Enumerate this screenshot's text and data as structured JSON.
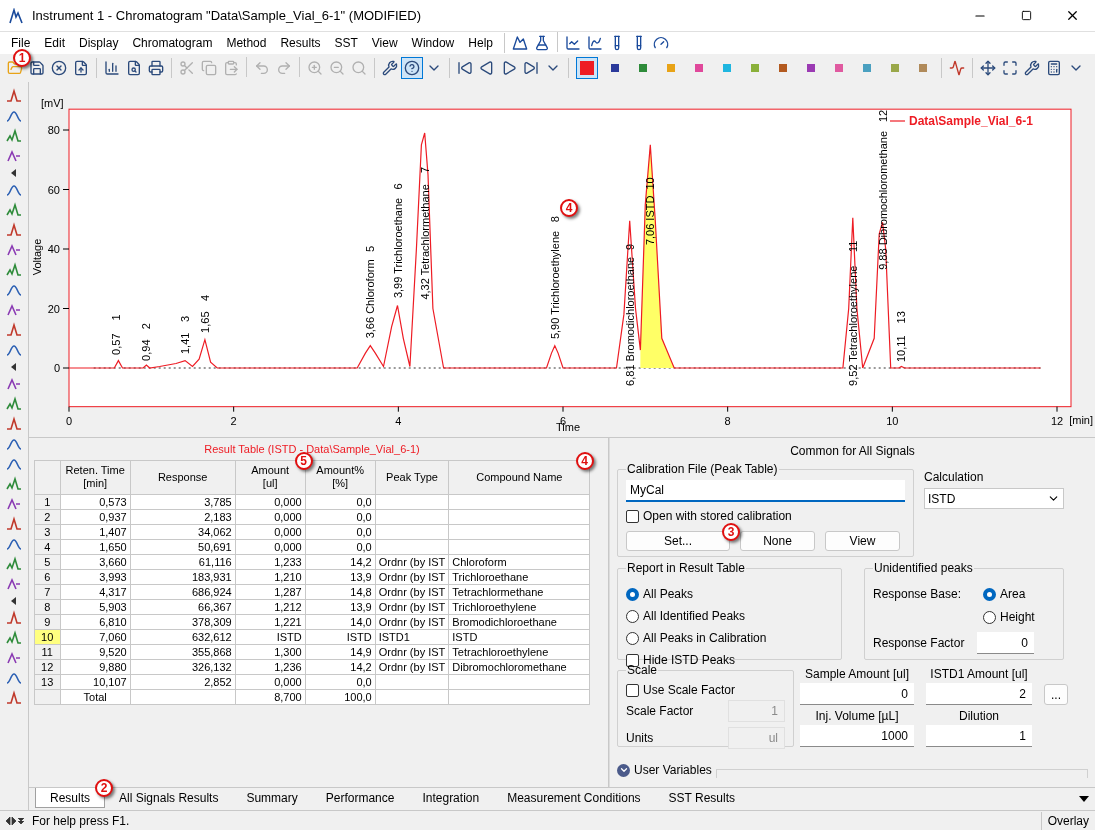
{
  "window": {
    "title": "Instrument 1 - Chromatogram \"Data\\Sample_Vial_6-1\" (MODIFIED)"
  },
  "menu": [
    "File",
    "Edit",
    "Display",
    "Chromatogram",
    "Method",
    "Results",
    "SST",
    "View",
    "Window",
    "Help"
  ],
  "toolbar": {
    "callout": "1",
    "colors": [
      {
        "color": "#ee1c24",
        "selected": true
      },
      {
        "color": "#2b3a9b",
        "selected": false
      },
      {
        "color": "#2e8b3a",
        "selected": false
      },
      {
        "color": "#e8a317",
        "selected": false
      },
      {
        "color": "#e0489b",
        "selected": false
      },
      {
        "color": "#1fb6e0",
        "selected": false
      },
      {
        "color": "#8ab03a",
        "selected": false
      },
      {
        "color": "#b35a1f",
        "selected": false
      },
      {
        "color": "#9b3ab3",
        "selected": false
      },
      {
        "color": "#e05aa0",
        "selected": false
      },
      {
        "color": "#4aa0c0",
        "selected": false
      },
      {
        "color": "#9aa84a",
        "selected": false
      },
      {
        "color": "#b08a5a",
        "selected": false
      }
    ]
  },
  "chart": {
    "callout": "4",
    "x_unit": "[min]",
    "y_unit": "[mV]",
    "peak_labels": [
      {
        "text": "0,57",
        "number": "1"
      },
      {
        "text": "0,94",
        "number": "2"
      },
      {
        "text": "1,41",
        "number": "3"
      },
      {
        "text": "1,65",
        "number": "4"
      },
      {
        "text": "3,66 Chloroform",
        "number": "5"
      },
      {
        "text": "3,99 Trichloroethane",
        "number": "6"
      },
      {
        "text": "4,32 Tetrachlormethane",
        "number": "7"
      },
      {
        "text": "5,90 Trichloroethylene",
        "number": "8"
      },
      {
        "text": "6,81 Bromodichloroethane",
        "number": "9"
      },
      {
        "text": "7,06 ISTD",
        "number": "10"
      },
      {
        "text": "9,52 Tetrachloroethylene",
        "number": "11"
      },
      {
        "text": "9,88 Dibromochloromethane",
        "number": "12"
      },
      {
        "text": "10,11",
        "number": "13"
      }
    ],
    "chart_data": {
      "type": "line",
      "xlabel": "Time",
      "ylabel": "Voltage",
      "xlim": [
        0,
        12.17
      ],
      "ylim": [
        -13,
        87
      ],
      "xticks": [
        0,
        2,
        4,
        6,
        8,
        10,
        12
      ],
      "yticks": [
        0,
        20,
        40,
        60,
        80
      ],
      "x": [
        0,
        0.55,
        0.6,
        0.65,
        0.9,
        0.94,
        0.98,
        1.1,
        1.3,
        1.41,
        1.5,
        1.58,
        1.65,
        1.72,
        1.8,
        3.5,
        3.6,
        3.66,
        3.72,
        3.82,
        3.92,
        3.99,
        4.06,
        4.14,
        4.22,
        4.28,
        4.32,
        4.36,
        4.42,
        4.55,
        5.8,
        5.86,
        5.9,
        5.94,
        6.0,
        6.65,
        6.74,
        6.81,
        6.88,
        6.94,
        7.0,
        7.06,
        7.12,
        7.2,
        7.35,
        9.4,
        9.47,
        9.52,
        9.57,
        9.64,
        9.78,
        9.84,
        9.88,
        9.92,
        9.98,
        10.08,
        10.11,
        10.15,
        11.8
      ],
      "series": [
        {
          "name": "Data\\Sample_Vial_6-1",
          "color": "#ee1c24",
          "values": [
            0,
            0,
            2.5,
            0,
            0,
            1,
            0,
            0.5,
            1.5,
            2.5,
            0.5,
            3,
            9.5,
            2,
            0,
            0,
            5,
            7.5,
            5,
            0.5,
            14,
            21,
            10,
            0.5,
            40,
            75,
            79,
            65,
            20,
            0,
            0,
            5,
            7.5,
            5,
            0,
            0,
            18,
            49.5,
            20,
            6,
            55,
            75,
            50,
            10,
            0,
            0,
            20,
            50.5,
            20,
            0,
            10,
            45,
            49,
            40,
            0,
            0,
            0.5,
            0,
            0
          ]
        }
      ]
    }
  },
  "result_table": {
    "title": "Result Table (ISTD - Data\\Sample_Vial_6-1)",
    "columns": [
      {},
      {
        "label": "Reten. Time",
        "unit": "[min]"
      },
      {
        "label": "Response"
      },
      {
        "label": "Amount",
        "unit": "[ul]",
        "callout": "5"
      },
      {
        "label": "Amount%",
        "unit": "[%]"
      },
      {
        "label": "Peak Type"
      },
      {
        "label": "Compound Name",
        "callout": "4"
      }
    ],
    "rows": [
      {
        "selected": false,
        "cells": [
          "1",
          "0,573",
          "3,785",
          "0,000",
          "0,0",
          "",
          ""
        ]
      },
      {
        "selected": false,
        "cells": [
          "2",
          "0,937",
          "2,183",
          "0,000",
          "0,0",
          "",
          ""
        ]
      },
      {
        "selected": false,
        "cells": [
          "3",
          "1,407",
          "34,062",
          "0,000",
          "0,0",
          "",
          ""
        ]
      },
      {
        "selected": false,
        "cells": [
          "4",
          "1,650",
          "50,691",
          "0,000",
          "0,0",
          "",
          ""
        ]
      },
      {
        "selected": false,
        "cells": [
          "5",
          "3,660",
          "61,116",
          "1,233",
          "14,2",
          "Ordnr (by IST",
          "Chloroform"
        ]
      },
      {
        "selected": false,
        "cells": [
          "6",
          "3,993",
          "183,931",
          "1,210",
          "13,9",
          "Ordnr (by IST",
          "Trichloroethane"
        ]
      },
      {
        "selected": false,
        "cells": [
          "7",
          "4,317",
          "686,924",
          "1,287",
          "14,8",
          "Ordnr (by IST",
          "Tetrachlormethane"
        ]
      },
      {
        "selected": false,
        "cells": [
          "8",
          "5,903",
          "66,367",
          "1,212",
          "13,9",
          "Ordnr (by IST",
          "Trichloroethylene"
        ]
      },
      {
        "selected": false,
        "cells": [
          "9",
          "6,810",
          "378,309",
          "1,221",
          "14,0",
          "Ordnr (by IST",
          "Bromodichloroethane"
        ]
      },
      {
        "selected": true,
        "cells": [
          "10",
          "7,060",
          "632,612",
          "ISTD",
          "ISTD",
          "ISTD1",
          "ISTD"
        ]
      },
      {
        "selected": false,
        "cells": [
          "11",
          "9,520",
          "355,868",
          "1,300",
          "14,9",
          "Ordnr (by IST",
          "Tetrachloroethylene"
        ]
      },
      {
        "selected": false,
        "cells": [
          "12",
          "9,880",
          "326,132",
          "1,236",
          "14,2",
          "Ordnr (by IST",
          "Dibromochloromethane"
        ]
      },
      {
        "selected": false,
        "cells": [
          "13",
          "10,107",
          "2,852",
          "0,000",
          "0,0",
          "",
          ""
        ]
      }
    ],
    "total": {
      "label": "Total",
      "cells": [
        "",
        "8,700",
        "100,0",
        "",
        ""
      ]
    }
  },
  "settings": {
    "heading": "Common for All Signals",
    "calibration": {
      "legend": "Calibration File (Peak Table)",
      "value": "MyCal",
      "open_stored": {
        "label": "Open with stored calibration",
        "checked": false
      },
      "buttons": [
        {
          "label": "Set...",
          "callout": "3"
        },
        {
          "label": "None"
        },
        {
          "label": "View"
        }
      ]
    },
    "calculation": {
      "label": "Calculation",
      "value": "ISTD"
    },
    "report": {
      "legend": "Report in Result Table",
      "options": [
        {
          "label": "All Peaks",
          "selected": true
        },
        {
          "label": "All Identified Peaks",
          "selected": false
        },
        {
          "label": "All Peaks in Calibration",
          "selected": false
        }
      ],
      "hide_istd": {
        "label": "Hide ISTD Peaks",
        "checked": false
      }
    },
    "unidentified": {
      "legend": "Unidentified peaks",
      "response_base_label": "Response Base:",
      "options": [
        {
          "label": "Area",
          "selected": true
        },
        {
          "label": "Height",
          "selected": false
        }
      ],
      "response_factor": {
        "label": "Response Factor",
        "value": "0"
      }
    },
    "scale": {
      "legend": "Scale",
      "use_scale": {
        "label": "Use Scale Factor",
        "checked": false
      },
      "scale_factor": {
        "label": "Scale Factor",
        "value": "1"
      },
      "units": {
        "label": "Units",
        "value": "ul"
      }
    },
    "fields": [
      {
        "label": "Sample Amount [ul]",
        "value": "0"
      },
      {
        "label": "ISTD1 Amount [ul]",
        "value": "2",
        "more": "..."
      },
      {
        "label": "Inj. Volume [µL]",
        "value": "1000"
      },
      {
        "label": "Dilution",
        "value": "1"
      }
    ],
    "user_variables": {
      "label": "User Variables",
      "expanded": false
    }
  },
  "tabs": [
    {
      "label": "Results",
      "selected": true,
      "callout": "2"
    },
    {
      "label": "All Signals Results",
      "selected": false
    },
    {
      "label": "Summary",
      "selected": false
    },
    {
      "label": "Performance",
      "selected": false
    },
    {
      "label": "Integration",
      "selected": false
    },
    {
      "label": "Measurement Conditions",
      "selected": false
    },
    {
      "label": "SST Results",
      "selected": false
    }
  ],
  "status_bar": {
    "help": "For help press F1.",
    "mode": "Overlay"
  }
}
